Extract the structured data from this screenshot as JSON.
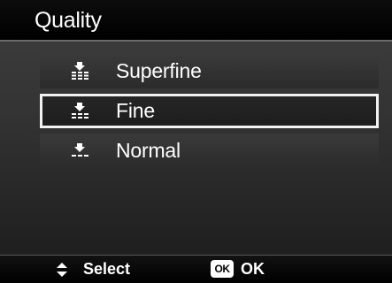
{
  "header": {
    "title": "Quality"
  },
  "menu": {
    "items": [
      {
        "label": "Superfine",
        "icon": "quality-superfine-icon",
        "selected": false
      },
      {
        "label": "Fine",
        "icon": "quality-fine-icon",
        "selected": true
      },
      {
        "label": "Normal",
        "icon": "quality-normal-icon",
        "selected": false
      }
    ]
  },
  "footer": {
    "select_icon": "up-down-arrows-icon",
    "select_label": "Select",
    "ok_icon_text": "OK",
    "ok_label": "OK"
  },
  "colors": {
    "background": "#333333",
    "highlight_border": "#f2f2f2",
    "text": "#ffffff"
  }
}
